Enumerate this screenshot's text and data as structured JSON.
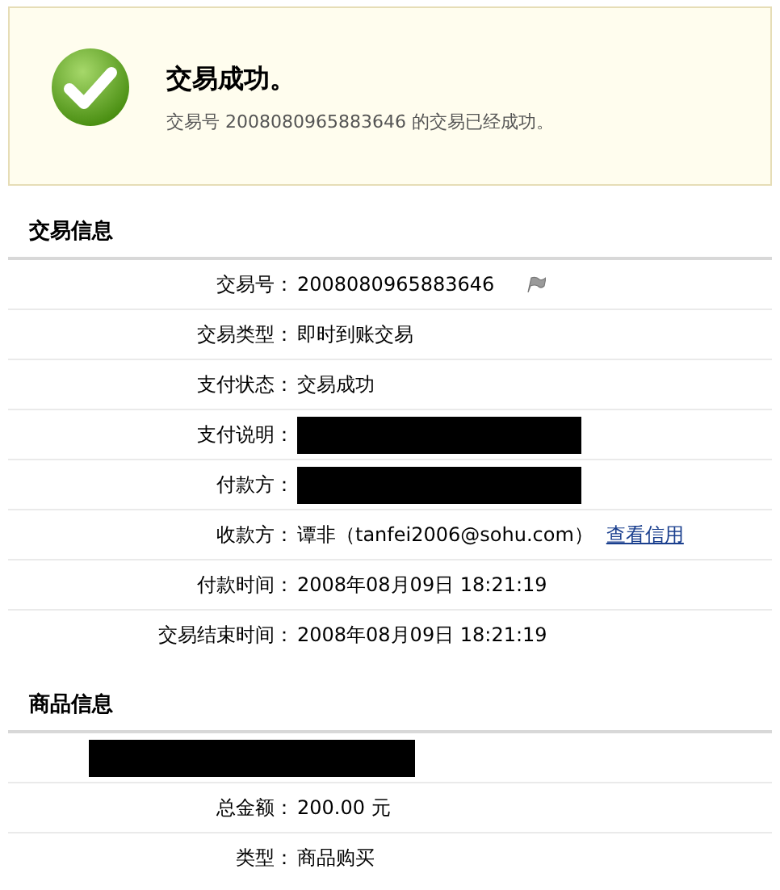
{
  "notice": {
    "title": "交易成功。",
    "message": "交易号 2008080965883646 的交易已经成功。"
  },
  "sections": [
    {
      "title": "交易信息",
      "rows": [
        {
          "kind": "text",
          "label": "交易号：",
          "value": "2008080965883646",
          "flag": true
        },
        {
          "kind": "text",
          "label": "交易类型：",
          "value": "即时到账交易"
        },
        {
          "kind": "text",
          "label": "支付状态：",
          "value": "交易成功"
        },
        {
          "kind": "redacted",
          "label": "支付说明："
        },
        {
          "kind": "redacted",
          "label": "付款方："
        },
        {
          "kind": "text",
          "label": "收款方：",
          "value": "谭非（tanfei2006@sohu.com）",
          "link": "查看信用"
        },
        {
          "kind": "text",
          "label": "付款时间：",
          "value": "2008年08月09日 18:21:19"
        },
        {
          "kind": "text",
          "label": "交易结束时间：",
          "value": "2008年08月09日 18:21:19"
        }
      ]
    },
    {
      "title": "商品信息",
      "rows": [
        {
          "kind": "redacted_line"
        },
        {
          "kind": "text",
          "label": "总金额：",
          "value": "200.00 元"
        },
        {
          "kind": "text",
          "label": "类型：",
          "value": "商品购买"
        }
      ]
    }
  ]
}
